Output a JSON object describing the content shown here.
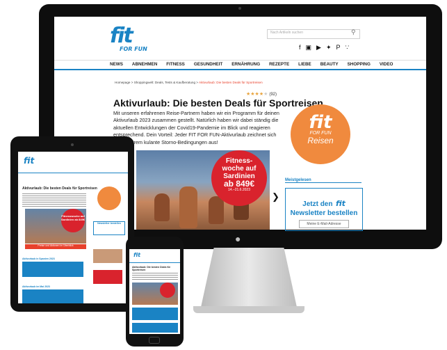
{
  "site": {
    "logo": {
      "main": "fit",
      "sub": "FOR FUN"
    },
    "search_placeholder": "Nach Artikeln suchen",
    "social_icons": [
      "facebook-icon",
      "instagram-icon",
      "youtube-icon",
      "twitter-icon",
      "pinterest-icon",
      "rss-icon"
    ],
    "nav": [
      "NEWS",
      "ABNEHMEN",
      "FITNESS",
      "GESUNDHEIT",
      "ERNÄHRUNG",
      "REZEPTE",
      "LIEBE",
      "BEAUTY",
      "SHOPPING",
      "VIDEO"
    ],
    "breadcrumb": [
      "Homepage",
      "Shoppingwelt: Deals, Tests & Kaufberatung",
      "Aktivurlaub: Die besten Deals für Sportreisen"
    ],
    "rating": {
      "stars": 4,
      "count": "(92)"
    },
    "title": "Aktivurlaub: Die besten Deals für Sportreisen",
    "intro": "Mit unseren erfahrenen Reise-Partnern haben wir ein Programm für deinen Aktivurlaub 2023 zusammen gestellt. Natürlich haben wir dabei ständig die aktuellen Entwicklungen der Covid19-Pandemie im Blick und reagieren entsprechend. Dein Vorteil: Jeder FIT FOR FUN-Aktivurlaub zeichnet sich durch extrem kulante Storno-Bedingungen aus!",
    "badge": {
      "line1": "Fitness-",
      "line2": "woche auf",
      "line3": "Sardinien",
      "line4": "ab 849€",
      "dates": "14.–21.6.2023"
    },
    "fitreisen": {
      "main": "fit",
      "sub": "FOR FUN",
      "tag": "Reisen"
    },
    "meistgelesen": "Meistgelesen",
    "newsletter": {
      "line1": "Jetzt den",
      "logo": "fit",
      "line2": "Newsletter bestellen",
      "input": "Meine E-Mail-Adresse"
    }
  },
  "tablet": {
    "title": "Aktivurlaub: Die besten Deals für Sportreisen",
    "badge": "Fitnesswoche auf Sardinien ab 849€",
    "cta": "Preise und Aktionen im Überblick",
    "newsletter": "Newsletter bestellen",
    "section1": "Aktivurlaub in Spanien 2023",
    "section2": "Aktivurlaub im Mai 2023"
  },
  "phone": {
    "title": "Aktivurlaub: Die besten Deals für Sportreisen"
  }
}
